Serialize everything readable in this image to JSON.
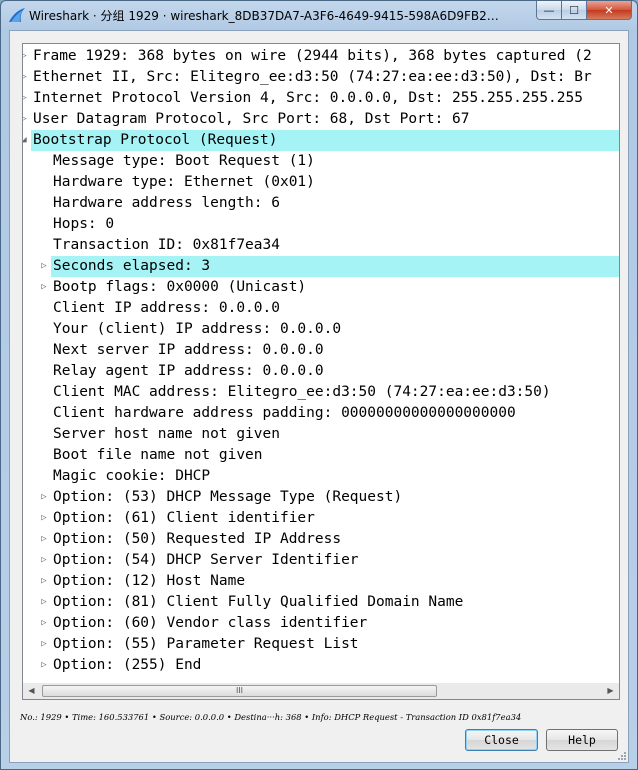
{
  "window": {
    "title": "Wireshark · 分组 1929 · wireshark_8DB37DA7-A3F6-4649-9415-598A6D9FB208_2018...",
    "minimize_label": "—",
    "maximize_label": "☐",
    "close_label": "✕"
  },
  "tree": {
    "rows": [
      {
        "indent": 0,
        "expander": "collapsed",
        "selected": false,
        "text": "Frame 1929: 368 bytes on wire (2944 bits), 368 bytes captured (2"
      },
      {
        "indent": 0,
        "expander": "collapsed",
        "selected": false,
        "text": "Ethernet II, Src: Elitegro_ee:d3:50 (74:27:ea:ee:d3:50), Dst: Br"
      },
      {
        "indent": 0,
        "expander": "collapsed",
        "selected": false,
        "text": "Internet Protocol Version 4, Src: 0.0.0.0, Dst: 255.255.255.255"
      },
      {
        "indent": 0,
        "expander": "collapsed",
        "selected": false,
        "text": "User Datagram Protocol, Src Port: 68, Dst Port: 67"
      },
      {
        "indent": 0,
        "expander": "expanded",
        "selected": true,
        "text": "Bootstrap Protocol (Request)"
      },
      {
        "indent": 1,
        "expander": "none",
        "selected": false,
        "text": "Message type: Boot Request (1)"
      },
      {
        "indent": 1,
        "expander": "none",
        "selected": false,
        "text": "Hardware type: Ethernet (0x01)"
      },
      {
        "indent": 1,
        "expander": "none",
        "selected": false,
        "text": "Hardware address length: 6"
      },
      {
        "indent": 1,
        "expander": "none",
        "selected": false,
        "text": "Hops: 0"
      },
      {
        "indent": 1,
        "expander": "none",
        "selected": false,
        "text": "Transaction ID: 0x81f7ea34"
      },
      {
        "indent": 1,
        "expander": "collapsed",
        "selected": true,
        "text": "Seconds elapsed: 3"
      },
      {
        "indent": 1,
        "expander": "collapsed",
        "selected": false,
        "text": "Bootp flags: 0x0000 (Unicast)"
      },
      {
        "indent": 1,
        "expander": "none",
        "selected": false,
        "text": "Client IP address: 0.0.0.0"
      },
      {
        "indent": 1,
        "expander": "none",
        "selected": false,
        "text": "Your (client) IP address: 0.0.0.0"
      },
      {
        "indent": 1,
        "expander": "none",
        "selected": false,
        "text": "Next server IP address: 0.0.0.0"
      },
      {
        "indent": 1,
        "expander": "none",
        "selected": false,
        "text": "Relay agent IP address: 0.0.0.0"
      },
      {
        "indent": 1,
        "expander": "none",
        "selected": false,
        "text": "Client MAC address: Elitegro_ee:d3:50 (74:27:ea:ee:d3:50)"
      },
      {
        "indent": 1,
        "expander": "none",
        "selected": false,
        "text": "Client hardware address padding: 00000000000000000000"
      },
      {
        "indent": 1,
        "expander": "none",
        "selected": false,
        "text": "Server host name not given"
      },
      {
        "indent": 1,
        "expander": "none",
        "selected": false,
        "text": "Boot file name not given"
      },
      {
        "indent": 1,
        "expander": "none",
        "selected": false,
        "text": "Magic cookie: DHCP"
      },
      {
        "indent": 1,
        "expander": "collapsed",
        "selected": false,
        "text": "Option: (53) DHCP Message Type (Request)"
      },
      {
        "indent": 1,
        "expander": "collapsed",
        "selected": false,
        "text": "Option: (61) Client identifier"
      },
      {
        "indent": 1,
        "expander": "collapsed",
        "selected": false,
        "text": "Option: (50) Requested IP Address"
      },
      {
        "indent": 1,
        "expander": "collapsed",
        "selected": false,
        "text": "Option: (54) DHCP Server Identifier"
      },
      {
        "indent": 1,
        "expander": "collapsed",
        "selected": false,
        "text": "Option: (12) Host Name"
      },
      {
        "indent": 1,
        "expander": "collapsed",
        "selected": false,
        "text": "Option: (81) Client Fully Qualified Domain Name"
      },
      {
        "indent": 1,
        "expander": "collapsed",
        "selected": false,
        "text": "Option: (60) Vendor class identifier"
      },
      {
        "indent": 1,
        "expander": "collapsed",
        "selected": false,
        "text": "Option: (55) Parameter Request List"
      },
      {
        "indent": 1,
        "expander": "collapsed",
        "selected": false,
        "text": "Option: (255) End"
      }
    ]
  },
  "scrollbar": {
    "left_arrow": "◀",
    "right_arrow": "▶",
    "thumb_grip": "III"
  },
  "status": {
    "text": "No.: 1929  •  Time: 160.533761  •  Source: 0.0.0.0  •  Destina···h: 368  •  Info: DHCP Request - Transaction ID 0x81f7ea34"
  },
  "buttons": {
    "close": "Close",
    "help": "Help"
  },
  "colors": {
    "selected_row": "#a6f3f6",
    "wireshark_fin": "#1f6fc5"
  }
}
